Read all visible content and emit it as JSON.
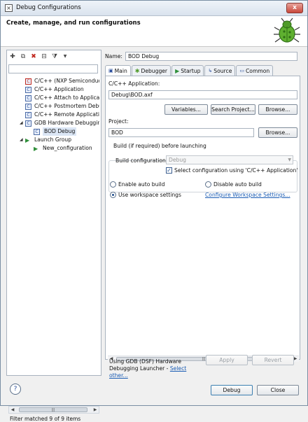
{
  "window": {
    "title": "Debug Configurations",
    "close_glyph": "x"
  },
  "header": {
    "heading": "Create, manage, and run configurations",
    "icon": "bug-icon"
  },
  "left": {
    "filter_text": "",
    "tree": [
      {
        "label": "C/C++ (NXP Semiconductors)",
        "icon": "c-config-icon"
      },
      {
        "label": "C/C++ Application",
        "icon": "c-config-icon"
      },
      {
        "label": "C/C++ Attach to Application",
        "icon": "c-config-icon"
      },
      {
        "label": "C/C++ Postmortem Debugger",
        "icon": "c-config-icon"
      },
      {
        "label": "C/C++ Remote Application",
        "icon": "c-config-icon"
      },
      {
        "label": "GDB Hardware Debugging",
        "icon": "c-config-icon",
        "expanded": true
      },
      {
        "label": "BOD Debug",
        "icon": "c-config-icon",
        "selected": true
      },
      {
        "label": "Launch Group",
        "icon": "launch-group-icon",
        "expanded": true
      },
      {
        "label": "New_configuration",
        "icon": "launch-group-icon"
      }
    ],
    "status": "Filter matched 9 of 9 items"
  },
  "config": {
    "name_label": "Name:",
    "name_value": "BOD Debug",
    "tabs": [
      {
        "label": "Main",
        "icon": "main-tab-icon"
      },
      {
        "label": "Debugger",
        "icon": "debugger-tab-icon"
      },
      {
        "label": "Startup",
        "icon": "startup-tab-icon"
      },
      {
        "label": "Source",
        "icon": "source-tab-icon"
      },
      {
        "label": "Common",
        "icon": "common-tab-icon"
      }
    ]
  },
  "main": {
    "app_label": "C/C++ Application:",
    "app_value": "Debug\\BOD.axf",
    "variables_btn": "Variables...",
    "search_project_btn": "Search Project...",
    "browse_btn_1": "Browse...",
    "project_label": "Project:",
    "project_value": "BOD",
    "browse_btn_2": "Browse...",
    "build_group_title": "Build (if required) before launching",
    "build_config_label": "Build configuration:",
    "build_config_value": "Debug",
    "select_config_check": "Select configuration using 'C/C++ Application'",
    "enable_auto_build": "Enable auto build",
    "disable_auto_build": "Disable auto build",
    "use_workspace": "Use workspace settings",
    "configure_workspace_link": "Configure Workspace Settings..."
  },
  "footer": {
    "launcher_text": "Using GDB (DSF) Hardware Debugging Launcher -",
    "select_other_link": "Select other...",
    "apply_btn": "Apply",
    "revert_btn": "Revert",
    "debug_btn": "Debug",
    "close_btn": "Close"
  }
}
